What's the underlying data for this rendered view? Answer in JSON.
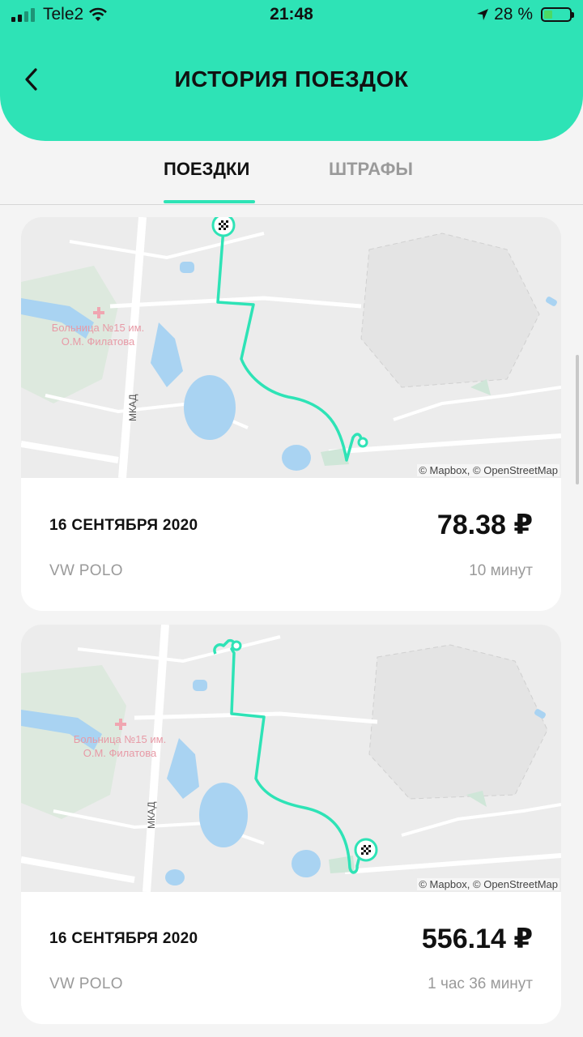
{
  "status_bar": {
    "carrier": "Tele2",
    "time": "21:48",
    "battery_percent": "28 %"
  },
  "header": {
    "title": "ИСТОРИЯ ПОЕЗДОК",
    "accent_color": "#2ee3b6"
  },
  "tabs": [
    {
      "label": "ПОЕЗДКИ",
      "active": true
    },
    {
      "label": "ШТРАФЫ",
      "active": false
    }
  ],
  "trips": [
    {
      "date": "16 СЕНТЯБРЯ 2020",
      "price": "78.38 ₽",
      "car": "VW POLO",
      "duration": "10 минут",
      "map": {
        "attribution": "© Mapbox, © OpenStreetMap",
        "hospital_label_line1": "Больница №15 им.",
        "hospital_label_line2": "О.М. Филатова",
        "road_label": "МКАД"
      }
    },
    {
      "date": "16 СЕНТЯБРЯ 2020",
      "price": "556.14 ₽",
      "car": "VW POLO",
      "duration": "1 час 36 минут",
      "map": {
        "attribution": "© Mapbox, © OpenStreetMap",
        "hospital_label_line1": "Больница №15 им.",
        "hospital_label_line2": "О.М. Филатова",
        "road_label": "МКАД"
      }
    }
  ]
}
